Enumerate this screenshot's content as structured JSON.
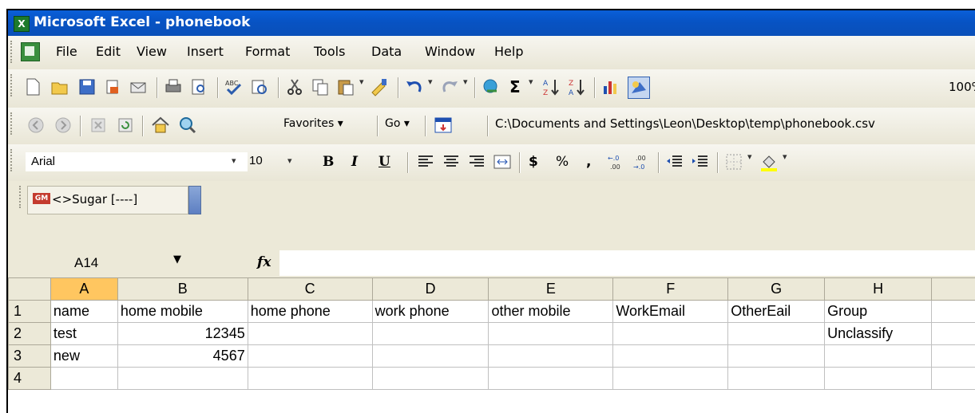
{
  "window": {
    "title": "Microsoft Excel - phonebook",
    "icon": "excel-app-icon"
  },
  "menu": {
    "items": [
      {
        "label": "File"
      },
      {
        "label": "Edit"
      },
      {
        "label": "View"
      },
      {
        "label": "Insert"
      },
      {
        "label": "Format"
      },
      {
        "label": "Tools"
      },
      {
        "label": "Data"
      },
      {
        "label": "Window"
      },
      {
        "label": "Help"
      }
    ]
  },
  "standard_toolbar": {
    "zoom": "100%"
  },
  "web_toolbar": {
    "favorites": "Favorites",
    "go": "Go",
    "address": "C:\\Documents and Settings\\Leon\\Desktop\\temp\\phonebook.csv"
  },
  "formatting_toolbar": {
    "font": "Arial",
    "size": "10",
    "bold": "B",
    "italic": "I",
    "underline": "U",
    "currency": "$",
    "percent": "%",
    "comma": ","
  },
  "sugar_toolbar": {
    "badge": "GM",
    "label": "<>Sugar [----]"
  },
  "formula_bar": {
    "name_box": "A14",
    "fx": "fx",
    "content": ""
  },
  "sheet": {
    "columns": [
      "A",
      "B",
      "C",
      "D",
      "E",
      "F",
      "G",
      "H"
    ],
    "active_column": "A",
    "rows": [
      {
        "num": "1",
        "cells": [
          "name",
          "home mobile",
          "home phone",
          "work phone",
          "other mobile",
          "WorkEmail",
          "OtherEail",
          "Group"
        ]
      },
      {
        "num": "2",
        "cells": [
          "test",
          "12345",
          "",
          "",
          "",
          "",
          "",
          "Unclassify"
        ]
      },
      {
        "num": "3",
        "cells": [
          "new",
          "4567",
          "",
          "",
          "",
          "",
          "",
          ""
        ]
      },
      {
        "num": "4",
        "cells": [
          "",
          "",
          "",
          "",
          "",
          "",
          "",
          ""
        ]
      }
    ]
  },
  "colors": {
    "titlebar": "#0a5fd8",
    "header": "#ece9d8",
    "active_header": "#ffc660"
  }
}
